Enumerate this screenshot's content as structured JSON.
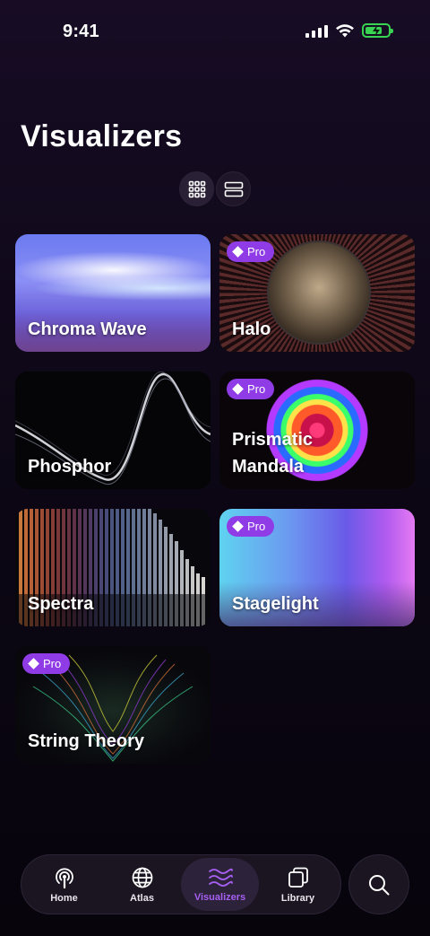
{
  "status_bar": {
    "time": "9:41"
  },
  "page": {
    "title": "Visualizers"
  },
  "view_toggle": {
    "options": [
      "grid-view",
      "list-view"
    ],
    "selected": "grid-view"
  },
  "cards": [
    {
      "label": "Chroma Wave",
      "pro": false,
      "art": "chroma-wave"
    },
    {
      "label": "Halo",
      "pro": true,
      "art": "halo"
    },
    {
      "label": "Phosphor",
      "pro": false,
      "art": "phosphor"
    },
    {
      "label": "Prismatic\nMandala",
      "pro": true,
      "art": "prismatic-mandala"
    },
    {
      "label": "Spectra",
      "pro": false,
      "art": "spectra"
    },
    {
      "label": "Stagelight",
      "pro": true,
      "art": "stagelight"
    },
    {
      "label": "String Theory",
      "pro": true,
      "art": "string-theory"
    }
  ],
  "pro_badge_label": "Pro",
  "tab_bar": {
    "items": [
      {
        "label": "Home",
        "icon": "podcast-icon"
      },
      {
        "label": "Atlas",
        "icon": "globe-icon"
      },
      {
        "label": "Visualizers",
        "icon": "waves-icon",
        "active": true
      },
      {
        "label": "Library",
        "icon": "library-icon"
      }
    ]
  },
  "colors": {
    "accent": "#a65ff2",
    "pro_badge": "#8f3ce6",
    "battery": "#39d353"
  }
}
